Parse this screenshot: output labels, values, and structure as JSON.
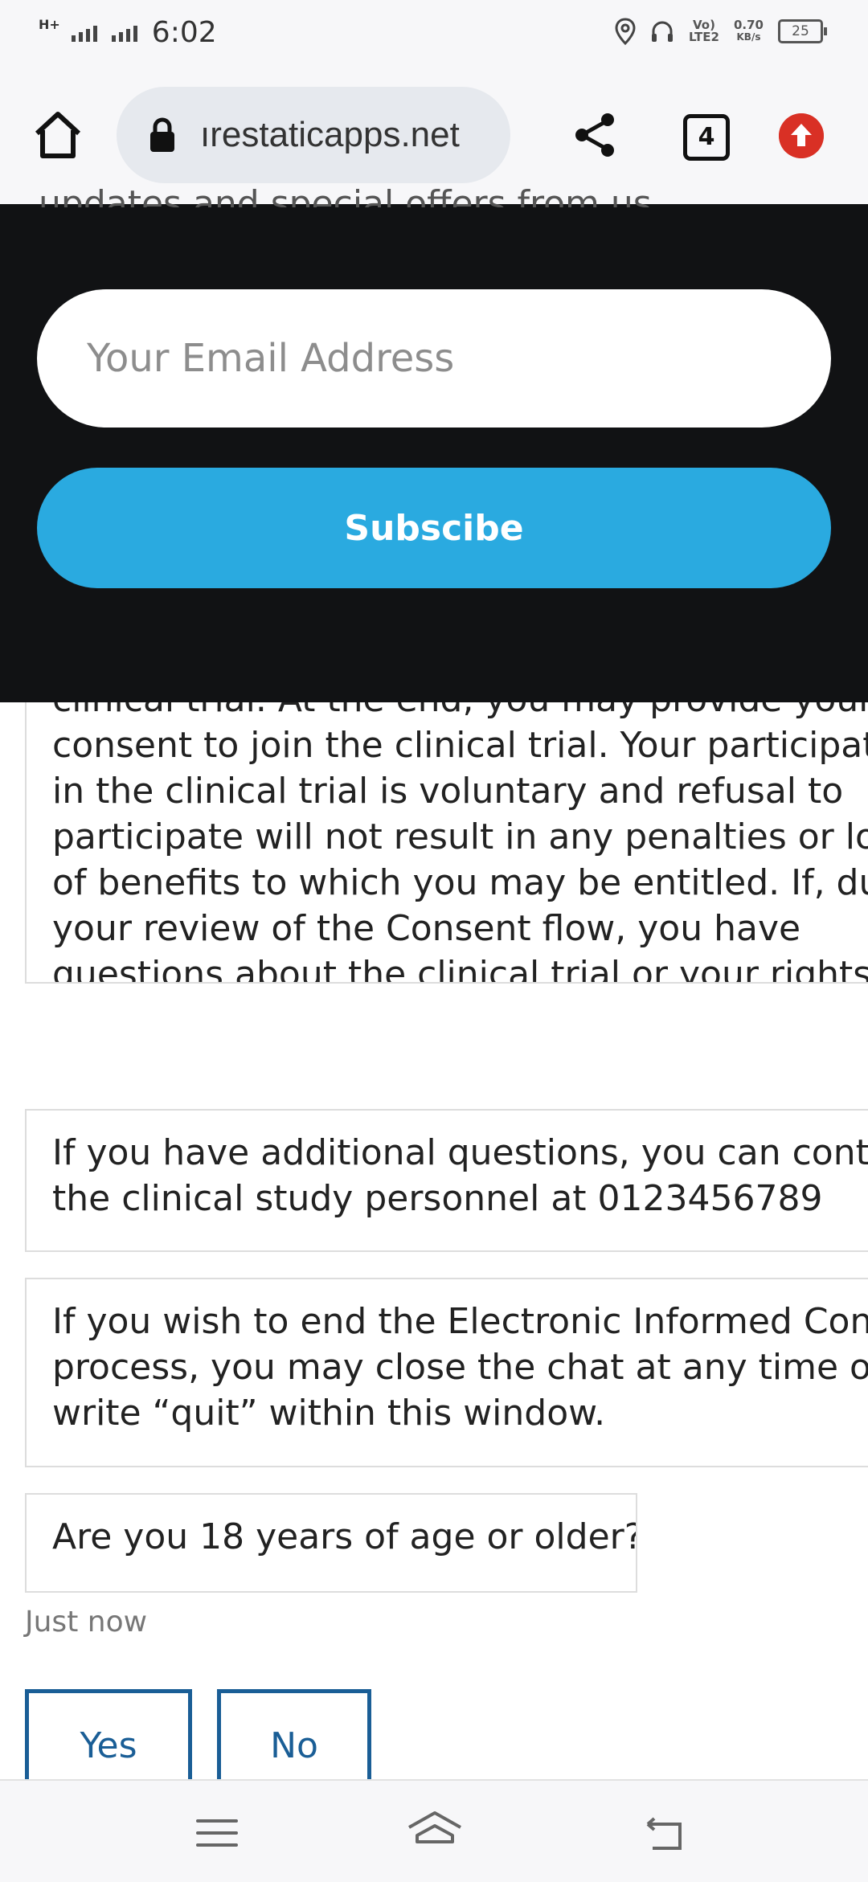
{
  "status_bar": {
    "time": "6:02",
    "network_left": "H+",
    "data_speed": "0.70",
    "data_unit": "KB/s",
    "volte": "Vo)",
    "lte": "LTE2",
    "battery": "25"
  },
  "browser": {
    "url": "ırestaticapps.net",
    "tab_count": "4"
  },
  "subscribe_panel": {
    "cut_text": "updates and special offers from us.",
    "email_placeholder": "Your Email Address",
    "button_label": "Subscibe"
  },
  "chat": {
    "messages": [
      {
        "text": "clinical trial. At the end, you may provide your\nconsent to join the clinical trial. Your participation\nin the clinical trial is voluntary and refusal to\nparticipate will not result in any penalties or loss\nof benefits to which you may be entitled. If, during\nyour review of the Consent flow, you have\nquestions about the clinical trial or your rights as a\nparticipant, please contact"
      },
      {
        "text": "If you have additional questions, you can contact\nthe clinical study personnel at 0123456789"
      },
      {
        "text": "If you wish to end the Electronic Informed Consent\nprocess, you may close the chat at any time or\nwrite “quit” within this window."
      },
      {
        "text": "Are you 18 years of age or older?"
      }
    ],
    "timestamp": "Just now",
    "options": [
      "Yes",
      "No"
    ]
  },
  "colors": {
    "accent": "#2aaae0",
    "option_border": "#1a5e96",
    "panel_bg": "#111214",
    "update_badge": "#d93025"
  }
}
